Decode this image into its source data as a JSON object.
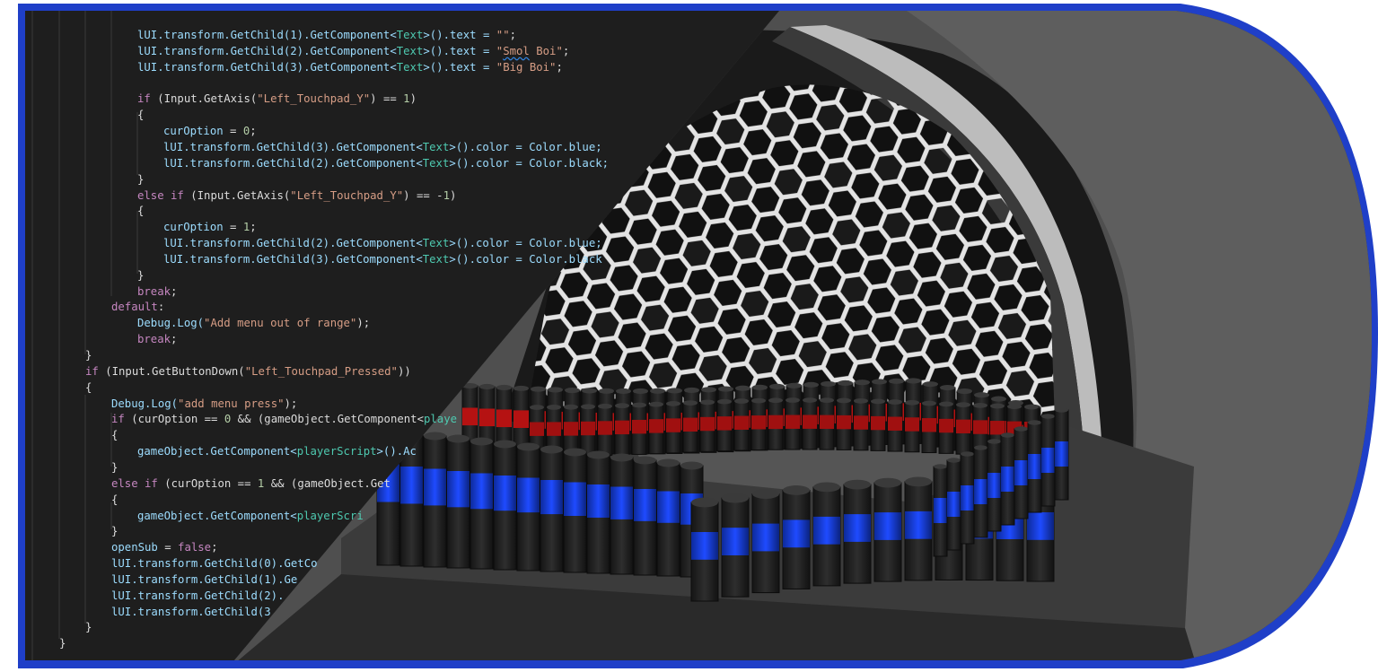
{
  "code_editor": {
    "lines": [
      {
        "indent": 4,
        "tokens": [
          [
            "v",
            "lUI.transform.GetChild(1).GetComponent<"
          ],
          [
            "t",
            "Text"
          ],
          [
            "v",
            ">().text = "
          ],
          [
            "s",
            "\"\""
          ],
          [
            "p",
            ";"
          ]
        ]
      },
      {
        "indent": 4,
        "tokens": [
          [
            "v",
            "lUI.transform.GetChild(2).GetComponent<"
          ],
          [
            "t",
            "Text"
          ],
          [
            "v",
            ">().text = "
          ],
          [
            "s",
            "\""
          ],
          [
            "q",
            "Smol"
          ],
          [
            "s",
            " Boi\""
          ],
          [
            "p",
            ";"
          ]
        ]
      },
      {
        "indent": 4,
        "tokens": [
          [
            "v",
            "lUI.transform.GetChild(3).GetComponent<"
          ],
          [
            "t",
            "Text"
          ],
          [
            "v",
            ">().text = "
          ],
          [
            "s",
            "\"Big Boi\""
          ],
          [
            "p",
            ";"
          ]
        ]
      },
      {
        "indent": 0,
        "tokens": []
      },
      {
        "indent": 4,
        "tokens": [
          [
            "k",
            "if"
          ],
          [
            "p",
            " (Input.GetAxis("
          ],
          [
            "s",
            "\"Left_Touchpad_Y\""
          ],
          [
            "p",
            ") == "
          ],
          [
            "n",
            "1"
          ],
          [
            "p",
            ")"
          ]
        ]
      },
      {
        "indent": 4,
        "tokens": [
          [
            "p",
            "{"
          ]
        ]
      },
      {
        "indent": 5,
        "tokens": [
          [
            "v",
            "curOption"
          ],
          [
            "p",
            " = "
          ],
          [
            "n",
            "0"
          ],
          [
            "p",
            ";"
          ]
        ]
      },
      {
        "indent": 5,
        "tokens": [
          [
            "v",
            "lUI.transform.GetChild(3).GetComponent<"
          ],
          [
            "t",
            "Text"
          ],
          [
            "v",
            ">().color = Color.blue;"
          ]
        ]
      },
      {
        "indent": 5,
        "tokens": [
          [
            "v",
            "lUI.transform.GetChild(2).GetComponent<"
          ],
          [
            "t",
            "Text"
          ],
          [
            "v",
            ">().color = Color.black;"
          ]
        ]
      },
      {
        "indent": 4,
        "tokens": [
          [
            "p",
            "}"
          ]
        ]
      },
      {
        "indent": 4,
        "tokens": [
          [
            "k",
            "else if"
          ],
          [
            "p",
            " (Input.GetAxis("
          ],
          [
            "s",
            "\"Left_Touchpad_Y\""
          ],
          [
            "p",
            ") == -"
          ],
          [
            "n",
            "1"
          ],
          [
            "p",
            ")"
          ]
        ]
      },
      {
        "indent": 4,
        "tokens": [
          [
            "p",
            "{"
          ]
        ]
      },
      {
        "indent": 5,
        "tokens": [
          [
            "v",
            "curOption"
          ],
          [
            "p",
            " = "
          ],
          [
            "n",
            "1"
          ],
          [
            "p",
            ";"
          ]
        ]
      },
      {
        "indent": 5,
        "tokens": [
          [
            "v",
            "lUI.transform.GetChild(2).GetComponent<"
          ],
          [
            "t",
            "Text"
          ],
          [
            "v",
            ">().color = Color.blue;"
          ]
        ]
      },
      {
        "indent": 5,
        "tokens": [
          [
            "v",
            "lUI.transform.GetChild(3).GetComponent<"
          ],
          [
            "t",
            "Text"
          ],
          [
            "v",
            ">().color = Color.black"
          ]
        ]
      },
      {
        "indent": 4,
        "tokens": [
          [
            "p",
            "}"
          ]
        ]
      },
      {
        "indent": 4,
        "tokens": [
          [
            "k",
            "break"
          ],
          [
            "p",
            ";"
          ]
        ]
      },
      {
        "indent": 3,
        "tokens": [
          [
            "k",
            "default"
          ],
          [
            "p",
            ":"
          ]
        ]
      },
      {
        "indent": 4,
        "tokens": [
          [
            "v",
            "Debug.Log("
          ],
          [
            "s",
            "\"Add menu out of range\""
          ],
          [
            "p",
            ");"
          ]
        ]
      },
      {
        "indent": 4,
        "tokens": [
          [
            "k",
            "break"
          ],
          [
            "p",
            ";"
          ]
        ]
      },
      {
        "indent": 2,
        "tokens": [
          [
            "p",
            "}"
          ]
        ]
      },
      {
        "indent": 2,
        "tokens": [
          [
            "k",
            "if"
          ],
          [
            "p",
            " (Input.GetButtonDown("
          ],
          [
            "s",
            "\"Left_Touchpad_Pressed\""
          ],
          [
            "p",
            "))"
          ]
        ]
      },
      {
        "indent": 2,
        "tokens": [
          [
            "p",
            "{"
          ]
        ]
      },
      {
        "indent": 3,
        "tokens": [
          [
            "v",
            "Debug.Log("
          ],
          [
            "s",
            "\"add menu press\""
          ],
          [
            "p",
            ");"
          ]
        ]
      },
      {
        "indent": 3,
        "tokens": [
          [
            "k",
            "if"
          ],
          [
            "p",
            " (curOption == "
          ],
          [
            "n",
            "0"
          ],
          [
            "p",
            " && (gameObject.GetComponent<"
          ],
          [
            "t",
            "playe"
          ]
        ]
      },
      {
        "indent": 3,
        "tokens": [
          [
            "p",
            "{"
          ]
        ]
      },
      {
        "indent": 4,
        "tokens": [
          [
            "v",
            "gameObject.GetComponent<"
          ],
          [
            "t",
            "playerScript"
          ],
          [
            "v",
            ">().Ac"
          ]
        ]
      },
      {
        "indent": 3,
        "tokens": [
          [
            "p",
            "}"
          ]
        ]
      },
      {
        "indent": 3,
        "tokens": [
          [
            "k",
            "else if"
          ],
          [
            "p",
            " (curOption == "
          ],
          [
            "n",
            "1"
          ],
          [
            "p",
            " && (gameObject.Get"
          ]
        ]
      },
      {
        "indent": 3,
        "tokens": [
          [
            "p",
            "{"
          ]
        ]
      },
      {
        "indent": 4,
        "tokens": [
          [
            "v",
            "gameObject.GetComponent<"
          ],
          [
            "t",
            "playerScri"
          ]
        ]
      },
      {
        "indent": 3,
        "tokens": [
          [
            "p",
            "}"
          ]
        ]
      },
      {
        "indent": 3,
        "tokens": [
          [
            "v",
            "openSub"
          ],
          [
            "p",
            " = "
          ],
          [
            "k",
            "false"
          ],
          [
            "p",
            ";"
          ]
        ]
      },
      {
        "indent": 3,
        "tokens": [
          [
            "v",
            "lUI.transform.GetChild(0).GetCo"
          ]
        ]
      },
      {
        "indent": 3,
        "tokens": [
          [
            "v",
            "lUI.transform.GetChild(1).Ge"
          ]
        ]
      },
      {
        "indent": 3,
        "tokens": [
          [
            "v",
            "lUI.transform.GetChild(2)."
          ]
        ]
      },
      {
        "indent": 3,
        "tokens": [
          [
            "v",
            "lUI.transform.GetChild(3"
          ]
        ]
      },
      {
        "indent": 2,
        "tokens": [
          [
            "p",
            "}"
          ]
        ]
      },
      {
        "indent": 1,
        "tokens": [
          [
            "p",
            "}"
          ]
        ]
      }
    ]
  },
  "colors": {
    "frame_blue": "#1f3fc8",
    "editor_bg": "#1e1e1e",
    "scene_bg": "#4a4a4a",
    "dome_bg": "#1b1b1b",
    "hex_stroke": "#e3e3e3",
    "pillar_dark": "#222222",
    "pillar_blue": "#1a3fd6",
    "pillar_red": "#c01010",
    "keyword": "#c586c0",
    "type": "#4ec9b0",
    "string": "#d69d85",
    "number": "#b5cea8",
    "identifier": "#9cdcfe"
  }
}
